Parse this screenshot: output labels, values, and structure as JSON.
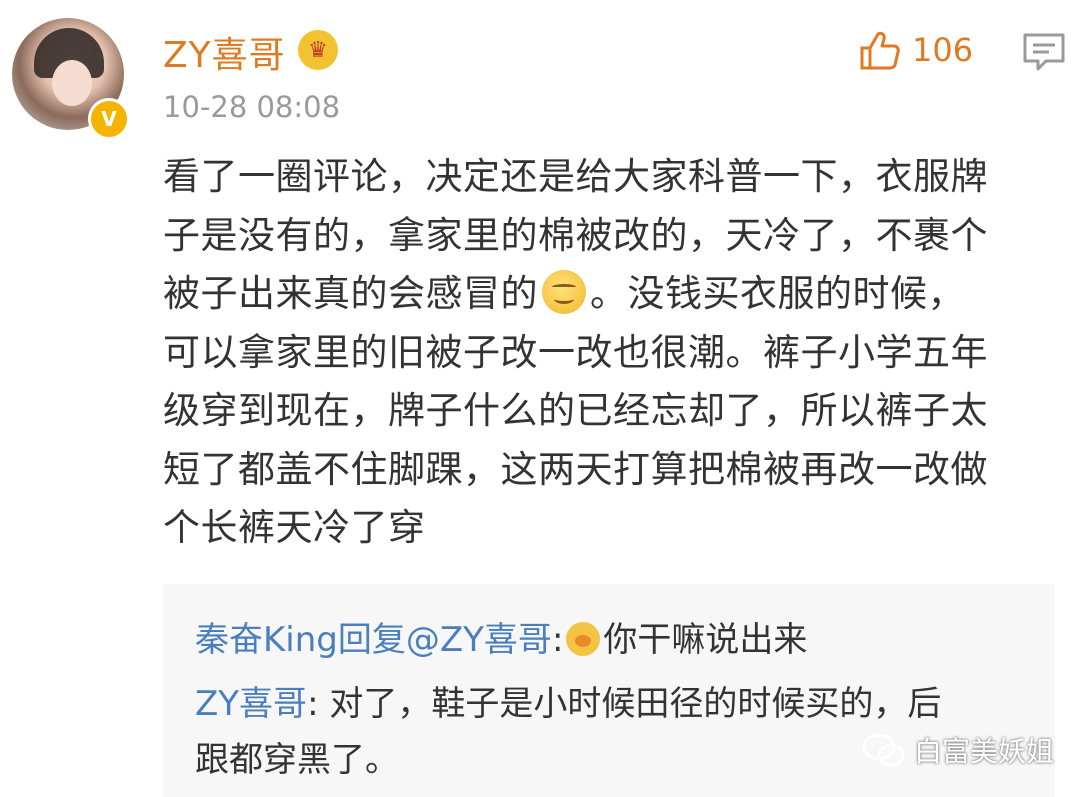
{
  "post": {
    "username": "ZY喜哥",
    "timestamp": "10-28 08:08",
    "like_count": "106",
    "body_lines": [
      "看了一圈评论，决定还是给大家科普一下，衣服牌",
      "子是没有的，拿家里的棉被改的，天冷了，不裹个",
      "被子出来真的会感冒的",
      "。没钱买衣服的时候，",
      "可以拿家里的旧被子改一改也很潮。裤子小学五年",
      "级穿到现在，牌子什么的已经忘却了，所以裤子太",
      "短了都盖不住脚踝，这两天打算把棉被再改一改做",
      "个长裤天冷了穿"
    ]
  },
  "reply": {
    "line1_name": "秦奋King回复@ZY喜哥",
    "line1_sep": ":",
    "line1_text": "你干嘛说出来",
    "line2_name": "ZY喜哥",
    "line2_text": ": 对了，鞋子是小时候田径的时候买的，后",
    "line3_text": "跟都穿黑了。"
  },
  "watermark": {
    "text": "白富美妖姐"
  },
  "icons": {
    "like": "thumbs-up-icon",
    "comment": "comment-icon",
    "badge": "verified-badge-icon",
    "emoji": "smile-emoji-icon",
    "watermark": "wechat-icon"
  },
  "colors": {
    "username": "#e07a22",
    "reply_name": "#4a7fbf",
    "badge": "#f5b400"
  }
}
